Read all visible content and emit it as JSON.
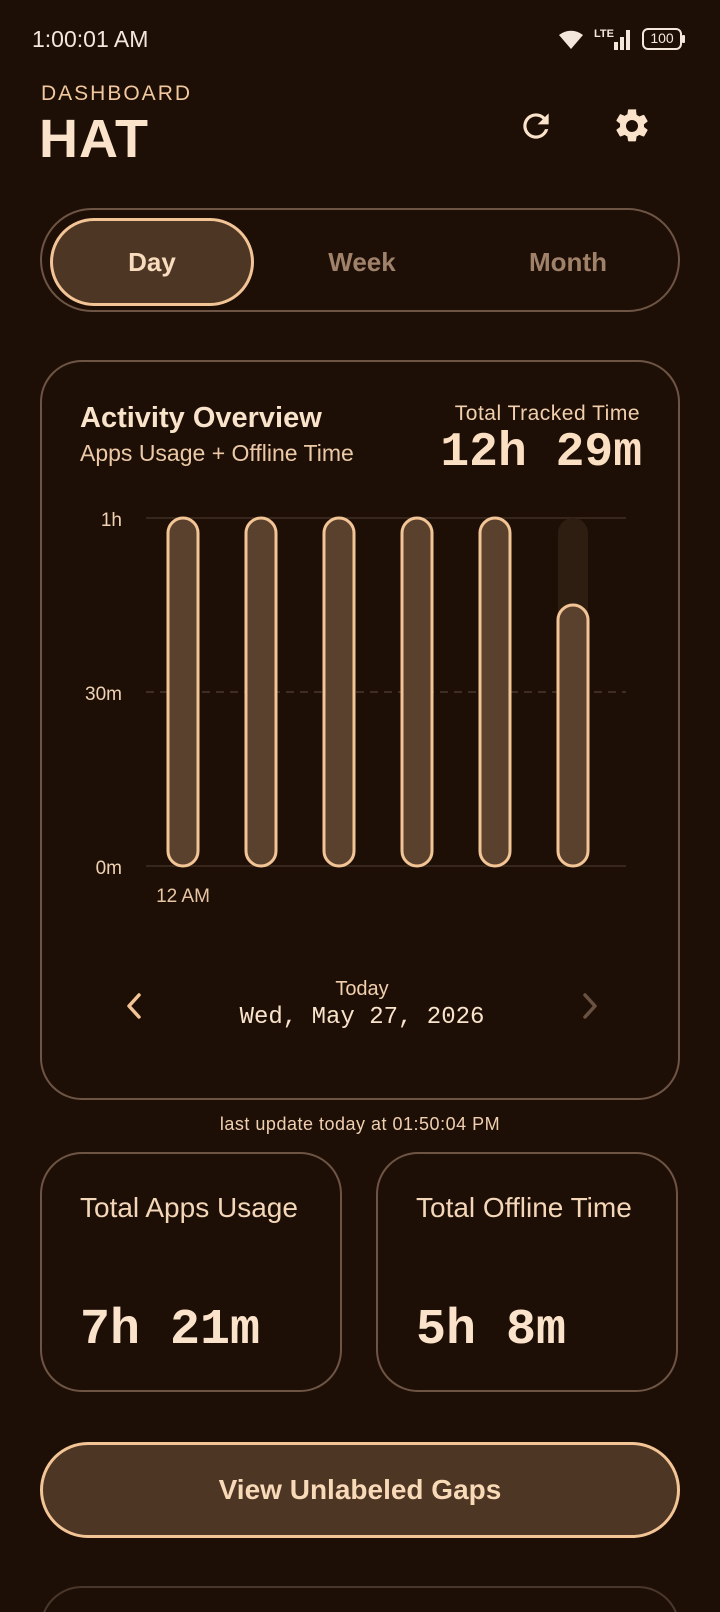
{
  "status_bar": {
    "time": "1:00:01 AM",
    "network": "LTE",
    "battery": "100"
  },
  "header": {
    "kicker": "DASHBOARD",
    "title": "HAT",
    "refresh_icon": "refresh-icon",
    "settings_icon": "gear-icon"
  },
  "tabs": [
    {
      "label": "Day",
      "selected": true
    },
    {
      "label": "Week",
      "selected": false
    },
    {
      "label": "Month",
      "selected": false
    }
  ],
  "activity_card": {
    "title": "Activity Overview",
    "subtitle": "Apps Usage + Offline Time",
    "total_label": "Total Tracked Time",
    "total_value": "12h 29m",
    "date_label": "Today",
    "date_full": "Wed, May 27, 2026",
    "prev_icon": "chevron-left-icon",
    "next_icon": "chevron-right-icon"
  },
  "chart_data": {
    "type": "bar",
    "y_ticks": [
      "0m",
      "30m",
      "1h"
    ],
    "ylim": [
      0,
      60
    ],
    "x_label_first": "12 AM",
    "values": [
      60,
      60,
      60,
      60,
      60,
      45
    ],
    "max_track": 60
  },
  "last_update": "last update today at 01:50:04 PM",
  "stats": {
    "apps": {
      "label": "Total Apps Usage",
      "value": "7h 21m"
    },
    "offline": {
      "label": "Total Offline Time",
      "value": "5h 8m"
    }
  },
  "gaps_button": {
    "label": "View Unlabeled Gaps"
  },
  "colors": {
    "background": "#1e0f06",
    "accent": "#f3c596",
    "bar_fill": "#5a412d",
    "card_border": "#6e5444"
  }
}
